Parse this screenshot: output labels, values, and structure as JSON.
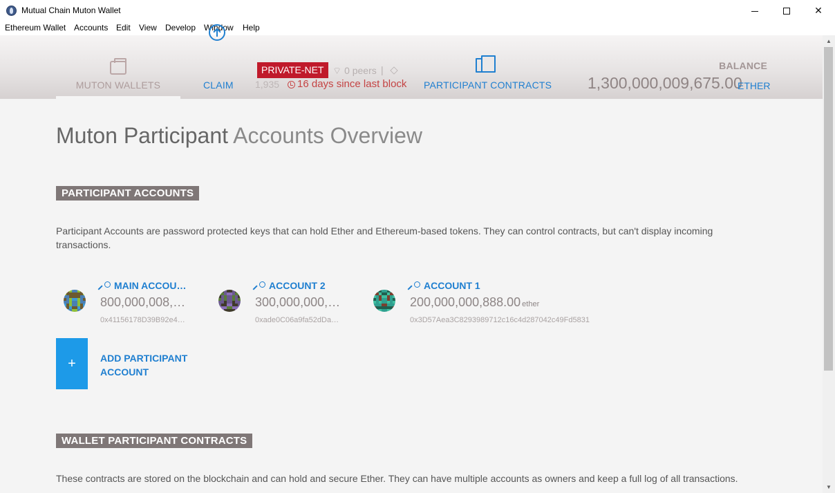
{
  "window": {
    "title": "Mutual Chain Muton Wallet",
    "controls": {
      "minimize": "",
      "maximize": "",
      "close": "✕"
    }
  },
  "menu": [
    "Ethereum Wallet",
    "Accounts",
    "Edit",
    "View",
    "Develop",
    "Window",
    "Help"
  ],
  "header": {
    "nav_wallets": "MUTON WALLETS",
    "nav_claim": "CLAIM",
    "network_badge": "PRIVATE-NET",
    "peers": "0 peers",
    "separator": "|",
    "block_number": "1,935",
    "last_block": "16 days since last block",
    "nav_contracts": "PARTICIPANT CONTRACTS",
    "balance_label": "BALANCE",
    "balance_value": "1,300,000,009,675.00",
    "balance_unit": "ETHER"
  },
  "page": {
    "title_bold": "Muton Participant",
    "title_light": "Accounts Overview"
  },
  "accounts_section": {
    "header": "PARTICIPANT ACCOUNTS",
    "description": "Participant Accounts are password protected keys that can hold Ether and Ethereum-based tokens. They can control contracts, but can't display incoming transactions.",
    "accounts": [
      {
        "name": "MAIN ACCOU…",
        "balance": "800,000,008,…",
        "unit": "",
        "address": "0x41156178D39B92e4…"
      },
      {
        "name": "ACCOUNT 2",
        "balance": "300,000,000,…",
        "unit": "",
        "address": "0xade0C06a9fa52dDa…"
      },
      {
        "name": "ACCOUNT 1",
        "balance": "200,000,000,888.00",
        "unit": "ether",
        "address": "0x3D57Aea3C8293989712c16c4d287042c49Fd5831"
      }
    ],
    "add_button_icon": "+",
    "add_button_label": "ADD PARTICIPANT ACCOUNT"
  },
  "contracts_section": {
    "header": "WALLET PARTICIPANT CONTRACTS",
    "description": "These contracts are stored on the blockchain and can hold and secure Ether. They can have multiple accounts as owners and keep a full log of all transactions."
  },
  "scrollbar": {
    "up": "▲",
    "down": "▼"
  },
  "colors": {
    "accent": "#1f7fd0",
    "badge": "#c01a2b",
    "section_header": "#7f7777",
    "add_button": "#1d9ae8"
  }
}
